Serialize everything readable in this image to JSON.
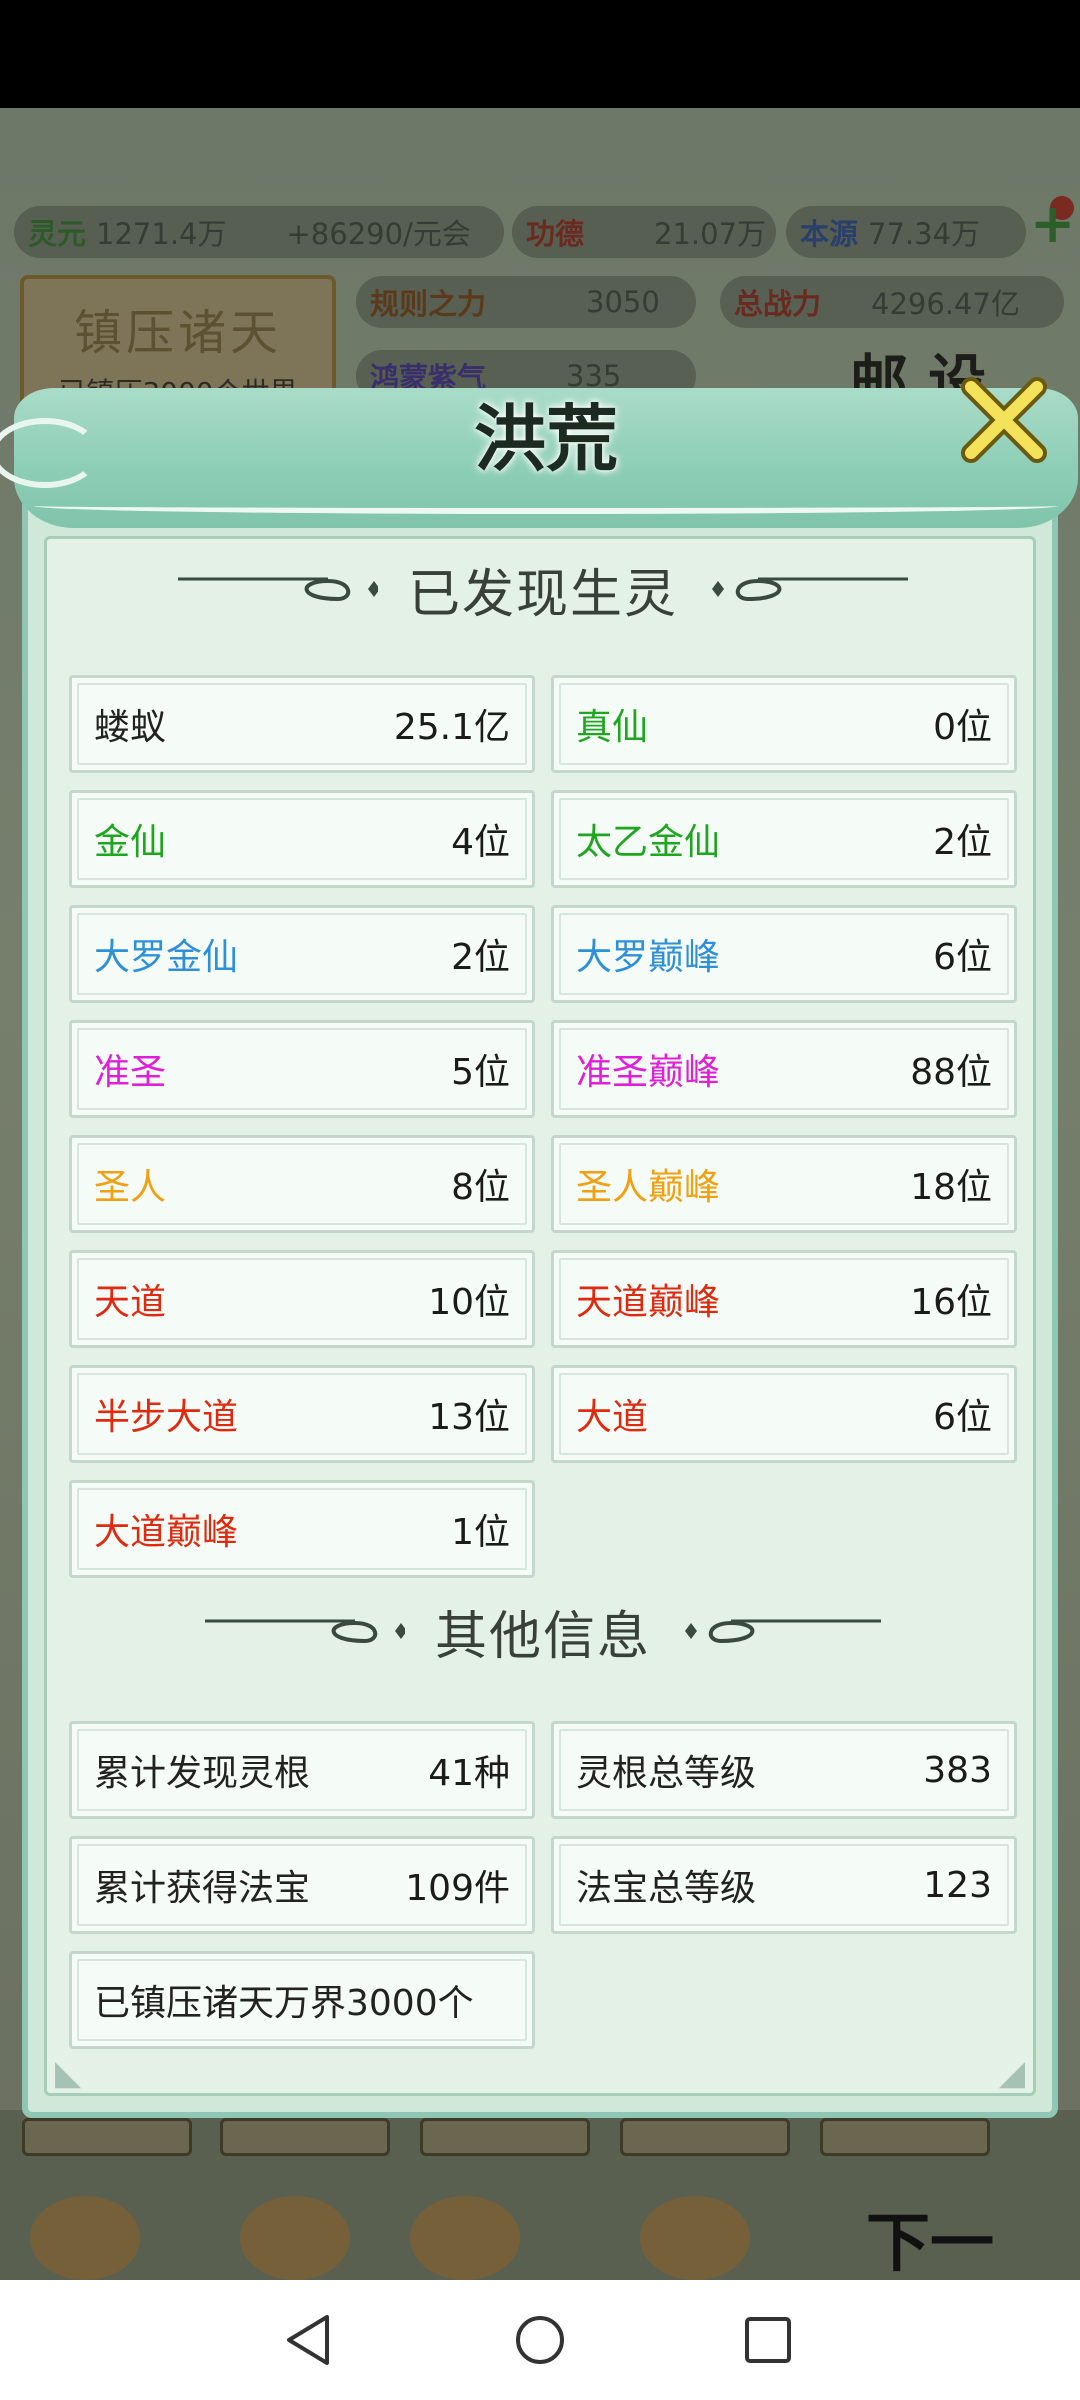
{
  "background": {
    "stats": {
      "lingyuan_label": "灵元",
      "lingyuan_value": "1271.4万",
      "rate": "+86290/元会",
      "gongde_label": "功德",
      "gongde_value": "21.07万",
      "benyuan_label": "本源",
      "benyuan_value": "77.34万",
      "guize_label": "规则之力",
      "guize_value": "3050",
      "zhanli_label": "总战力",
      "zhanli_value": "4296.47亿",
      "hongmeng_label": "鸿蒙紫气",
      "hongmeng_value": "335"
    },
    "suppress_title": "镇压诸天",
    "suppress_sub": "已镇压3000个世界",
    "corner_text": "邮 设",
    "next_label": "下一"
  },
  "modal": {
    "title": "洪荒",
    "section1_title": "已发现生灵",
    "beings": [
      {
        "name": "蝼蚁",
        "value": "25.1亿",
        "color": "#222222"
      },
      {
        "name": "真仙",
        "value": "0位",
        "color": "#1fa51f"
      },
      {
        "name": "金仙",
        "value": "4位",
        "color": "#1fa51f"
      },
      {
        "name": "太乙金仙",
        "value": "2位",
        "color": "#1fa51f"
      },
      {
        "name": "大罗金仙",
        "value": "2位",
        "color": "#2f90d8"
      },
      {
        "name": "大罗巅峰",
        "value": "6位",
        "color": "#2f90d8"
      },
      {
        "name": "准圣",
        "value": "5位",
        "color": "#e020d8"
      },
      {
        "name": "准圣巅峰",
        "value": "88位",
        "color": "#e020d8"
      },
      {
        "name": "圣人",
        "value": "8位",
        "color": "#f0a010"
      },
      {
        "name": "圣人巅峰",
        "value": "18位",
        "color": "#f0a010"
      },
      {
        "name": "天道",
        "value": "10位",
        "color": "#e02a10"
      },
      {
        "name": "天道巅峰",
        "value": "16位",
        "color": "#e02a10"
      },
      {
        "name": "半步大道",
        "value": "13位",
        "color": "#e02a10"
      },
      {
        "name": "大道",
        "value": "6位",
        "color": "#e02a10"
      },
      {
        "name": "大道巅峰",
        "value": "1位",
        "color": "#e02a10"
      }
    ],
    "section2_title": "其他信息",
    "info": [
      {
        "name": "累计发现灵根",
        "value": "41种"
      },
      {
        "name": "灵根总等级",
        "value": "383"
      },
      {
        "name": "累计获得法宝",
        "value": "109件"
      },
      {
        "name": "法宝总等级",
        "value": "123"
      },
      {
        "name": "已镇压诸天万界3000个",
        "value": ""
      }
    ]
  },
  "icons": {
    "close": "close-icon",
    "nav_back": "back-triangle-icon",
    "nav_home": "home-circle-icon",
    "nav_recents": "recents-square-icon"
  }
}
